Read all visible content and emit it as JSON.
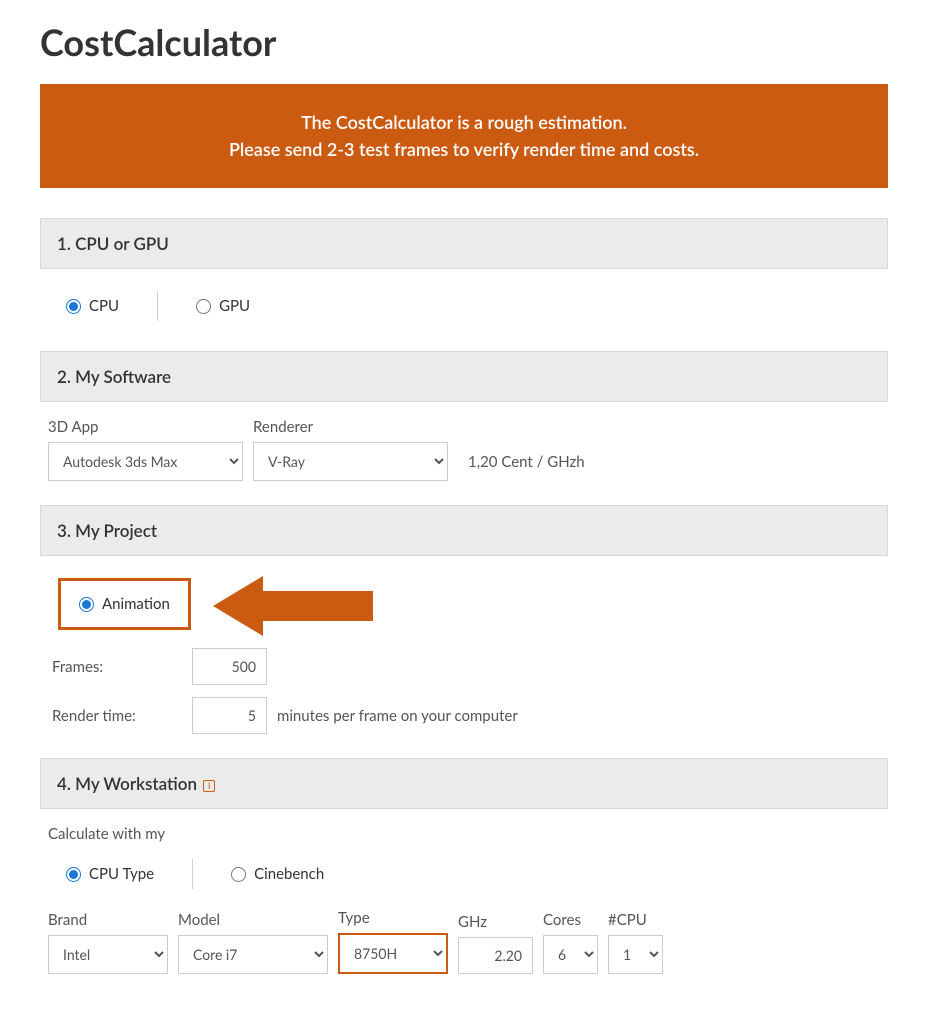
{
  "title": "CostCalculator",
  "banner": {
    "line1": "The CostCalculator is a rough estimation.",
    "line2": "Please send 2-3 test frames to verify render time and costs."
  },
  "sections": {
    "cpu_gpu": {
      "title": "1. CPU or GPU",
      "options": {
        "cpu": "CPU",
        "gpu": "GPU"
      }
    },
    "software": {
      "title": "2. My Software",
      "app_label": "3D App",
      "app_value": "Autodesk 3ds Max",
      "renderer_label": "Renderer",
      "renderer_value": "V-Ray",
      "price": "1,20 Cent / GHzh"
    },
    "project": {
      "title": "3. My Project",
      "animation": "Animation",
      "frames_label": "Frames:",
      "frames_value": "500",
      "rendertime_label": "Render time:",
      "rendertime_value": "5",
      "rendertime_suffix": "minutes per frame on your computer"
    },
    "workstation": {
      "title": "4. My Workstation",
      "calc_label": "Calculate with my",
      "cpu_type": "CPU Type",
      "cinebench": "Cinebench",
      "brand_label": "Brand",
      "brand_value": "Intel",
      "model_label": "Model",
      "model_value": "Core i7",
      "type_label": "Type",
      "type_value": "8750H",
      "ghz_label": "GHz",
      "ghz_value": "2.20",
      "cores_label": "Cores",
      "cores_value": "6",
      "cpu_label": "#CPU",
      "cpu_value": "1"
    }
  }
}
